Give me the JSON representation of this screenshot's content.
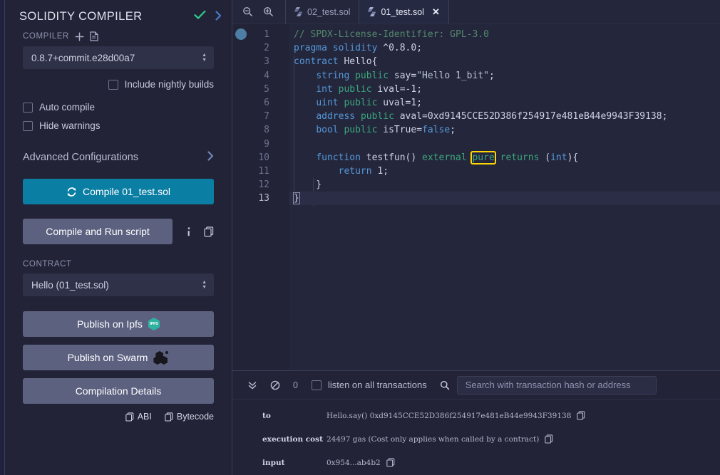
{
  "compiler_panel": {
    "title": "SOLIDITY COMPILER",
    "header_icons": {
      "check": "check-icon",
      "chevron": "chevron-right-icon"
    },
    "compiler_label": "COMPILER",
    "compiler_add_icon": "plus-icon",
    "compiler_file_icon": "file-icon",
    "compiler_version": "0.8.7+commit.e28d00a7",
    "include_nightly_label": "Include nightly builds",
    "auto_compile_label": "Auto compile",
    "hide_warnings_label": "Hide warnings",
    "advanced_label": "Advanced Configurations",
    "compile_button": "Compile 01_test.sol",
    "compile_refresh_icon": "refresh-icon",
    "compile_run_button": "Compile and Run script",
    "info_icon": "info-icon",
    "copy_icon": "copy-icon",
    "contract_label": "CONTRACT",
    "contract_value": "Hello (01_test.sol)",
    "publish_ipfs": "Publish on Ipfs",
    "ipfs_badge_text": "IPFS",
    "publish_swarm": "Publish on Swarm",
    "compilation_details": "Compilation Details",
    "abi_label": "ABI",
    "bytecode_label": "Bytecode",
    "accent_primary": "#0b7ea3",
    "accent_secondary": "#5d6180",
    "accent_check": "#30c88b"
  },
  "tabbar": {
    "zoom_out_icon": "zoom-out-icon",
    "zoom_in_icon": "zoom-in-icon",
    "tabs": [
      {
        "label": "02_test.sol",
        "icon": "solidity-icon",
        "active": false,
        "closable": false
      },
      {
        "label": "01_test.sol",
        "icon": "solidity-icon",
        "active": true,
        "closable": true
      }
    ],
    "close_icon": "close-icon"
  },
  "editor": {
    "line_numbers": [
      "1",
      "2",
      "3",
      "4",
      "5",
      "6",
      "7",
      "8",
      "9",
      "10",
      "11",
      "12",
      "13"
    ],
    "current_line": "13",
    "fold_lines": [
      "3",
      "10"
    ],
    "lines": [
      {
        "n": "1",
        "tokens": [
          {
            "t": "// SPDX-License-Identifier: GPL-3.0",
            "c": "com"
          }
        ]
      },
      {
        "n": "2",
        "tokens": [
          {
            "t": "pragma",
            "c": "kw"
          },
          {
            "t": " ",
            "c": "pl"
          },
          {
            "t": "solidity",
            "c": "kw"
          },
          {
            "t": " ^0.8.0;",
            "c": "pl"
          }
        ]
      },
      {
        "n": "3",
        "tokens": [
          {
            "t": "contract",
            "c": "kw"
          },
          {
            "t": " Hello",
            "c": "pl"
          },
          {
            "t": "{",
            "c": "pl"
          }
        ]
      },
      {
        "n": "4",
        "tokens": [
          {
            "t": "    ",
            "c": "pl"
          },
          {
            "t": "string",
            "c": "kw"
          },
          {
            "t": " ",
            "c": "pl"
          },
          {
            "t": "public",
            "c": "kw2"
          },
          {
            "t": " say=",
            "c": "pl"
          },
          {
            "t": "\"Hello 1_bit\"",
            "c": "str"
          },
          {
            "t": ";",
            "c": "pl"
          }
        ]
      },
      {
        "n": "5",
        "tokens": [
          {
            "t": "    ",
            "c": "pl"
          },
          {
            "t": "int",
            "c": "kw"
          },
          {
            "t": " ",
            "c": "pl"
          },
          {
            "t": "public",
            "c": "kw2"
          },
          {
            "t": " ival=-1;",
            "c": "pl"
          }
        ]
      },
      {
        "n": "6",
        "tokens": [
          {
            "t": "    ",
            "c": "pl"
          },
          {
            "t": "uint",
            "c": "kw"
          },
          {
            "t": " ",
            "c": "pl"
          },
          {
            "t": "public",
            "c": "kw2"
          },
          {
            "t": " uval=1;",
            "c": "pl"
          }
        ]
      },
      {
        "n": "7",
        "tokens": [
          {
            "t": "    ",
            "c": "pl"
          },
          {
            "t": "address",
            "c": "kw"
          },
          {
            "t": " ",
            "c": "pl"
          },
          {
            "t": "public",
            "c": "kw2"
          },
          {
            "t": " aval=0xd9145CCE52D386f254917e481eB44e9943F39138;",
            "c": "pl"
          }
        ]
      },
      {
        "n": "8",
        "tokens": [
          {
            "t": "    ",
            "c": "pl"
          },
          {
            "t": "bool",
            "c": "kw"
          },
          {
            "t": " ",
            "c": "pl"
          },
          {
            "t": "public",
            "c": "kw2"
          },
          {
            "t": " isTrue=",
            "c": "pl"
          },
          {
            "t": "false",
            "c": "kw"
          },
          {
            "t": ";",
            "c": "pl"
          }
        ]
      },
      {
        "n": "9",
        "tokens": [
          {
            "t": "",
            "c": "pl"
          }
        ]
      },
      {
        "n": "10",
        "tokens": [
          {
            "t": "    ",
            "c": "pl"
          },
          {
            "t": "function",
            "c": "kw"
          },
          {
            "t": " testfun() ",
            "c": "pl"
          },
          {
            "t": "external",
            "c": "kw2"
          },
          {
            "t": " ",
            "c": "pl"
          },
          {
            "t": "pure",
            "c": "kw2 hl-box"
          },
          {
            "t": " ",
            "c": "pl"
          },
          {
            "t": "returns",
            "c": "kw2"
          },
          {
            "t": " (",
            "c": "pl"
          },
          {
            "t": "int",
            "c": "kw"
          },
          {
            "t": "){",
            "c": "pl"
          }
        ]
      },
      {
        "n": "11",
        "tokens": [
          {
            "t": "        ",
            "c": "pl"
          },
          {
            "t": "return",
            "c": "kw"
          },
          {
            "t": " 1;",
            "c": "pl"
          }
        ]
      },
      {
        "n": "12",
        "tokens": [
          {
            "t": "    }",
            "c": "pl"
          }
        ]
      },
      {
        "n": "13",
        "tokens": [
          {
            "t": "}",
            "c": "pl cursor-box"
          }
        ]
      }
    ],
    "highlight_token": "pure",
    "highlight_color": "#ffd700"
  },
  "terminal": {
    "collapse_icon": "chevrons-down-icon",
    "clear_icon": "ban-icon",
    "count": "0",
    "listen_label": "listen on all transactions",
    "search_icon": "search-icon",
    "search_placeholder": "Search with transaction hash or address",
    "search_value": "",
    "rows": [
      {
        "key": "to",
        "value": "Hello.say() 0xd9145CCE52D386f254917e481eB44e9943F39138",
        "copy_icon": "copy-icon"
      },
      {
        "key": "execution cost",
        "value": "24497 gas (Cost only applies when called by a contract)",
        "copy_icon": "copy-icon"
      },
      {
        "key": "input",
        "value": "0x954...ab4b2",
        "copy_icon": "copy-icon"
      }
    ]
  }
}
